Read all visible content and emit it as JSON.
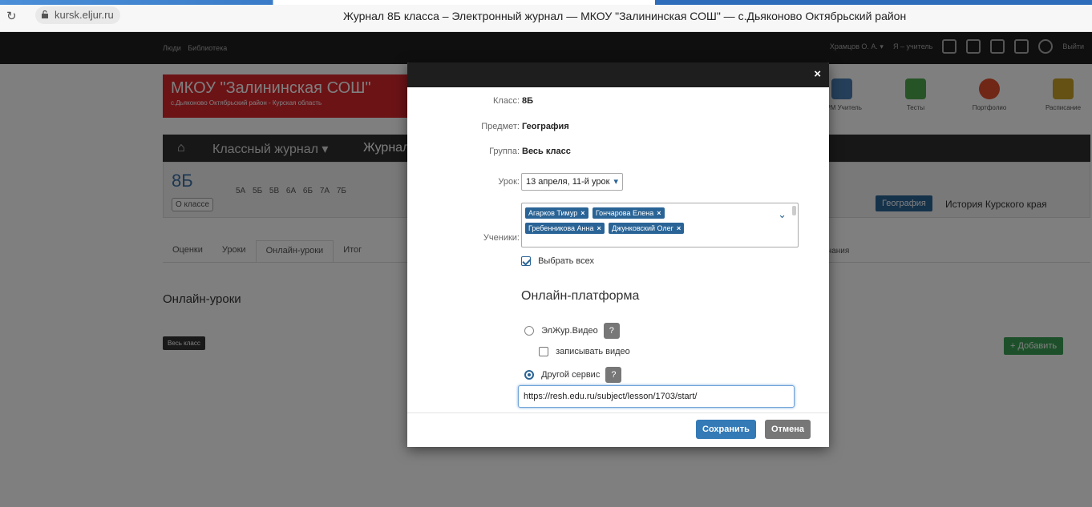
{
  "browser": {
    "url": "kursk.eljur.ru",
    "title": "Журнал 8Б класса  – Электронный журнал — МКОУ \"Залининская СОШ\"  — с.Дьяконово Октябрьский район"
  },
  "topnav": {
    "links": [
      "Люди",
      "Библиотека"
    ],
    "user": "Храмцов О. А. ▾",
    "role": "Я – учитель",
    "logout": "Выйти"
  },
  "school": {
    "name": "МКОУ \"Залининская СОШ\"",
    "sub": "с.Дьяконово Октябрьский район - Курская область"
  },
  "apps": [
    {
      "label": "АРМ Учитель",
      "color": "#4a7fb5"
    },
    {
      "label": "Тесты",
      "color": "#4fa84f"
    },
    {
      "label": "Портфолио",
      "color": "#e04e2a"
    },
    {
      "label": "Расписание",
      "color": "#c9a227"
    }
  ],
  "journal": {
    "crumb1": "Классный журнал ▾",
    "crumb2": "Журнал"
  },
  "classbar": {
    "current": "8Б",
    "about": "О классе",
    "classes": "5А 5Б 5В 6А 6Б 7А 7Б",
    "subject_active": "География",
    "subject_other": "История Курского края"
  },
  "tabs": [
    "Оценки",
    "Уроки",
    "Онлайн-уроки",
    "Итог"
  ],
  "tab_extra": "чания",
  "section": {
    "title": "Онлайн-уроки",
    "filter": "Весь класс",
    "add": "+ Добавить"
  },
  "modal": {
    "class_label": "Класс:",
    "class_value": "8Б",
    "subject_label": "Предмет:",
    "subject_value": "География",
    "group_label": "Группа:",
    "group_value": "Весь класс",
    "lesson_label": "Урок:",
    "lesson_value": "13 апреля, 11-й урок",
    "students_label": "Ученики:",
    "students": [
      "Агарков Тимур",
      "Гончарова Елена",
      "Гребенникова Анна",
      "Джунковский Олег"
    ],
    "select_all": "Выбрать всех",
    "select_all_checked": true,
    "platform_title": "Онлайн-платформа",
    "opt_video": "ЭлЖур.Видео",
    "record_video": "записывать видео",
    "opt_other": "Другой сервис",
    "other_selected": true,
    "url": "https://resh.edu.ru/subject/lesson/1703/start/",
    "save": "Сохранить",
    "cancel": "Отмена"
  }
}
